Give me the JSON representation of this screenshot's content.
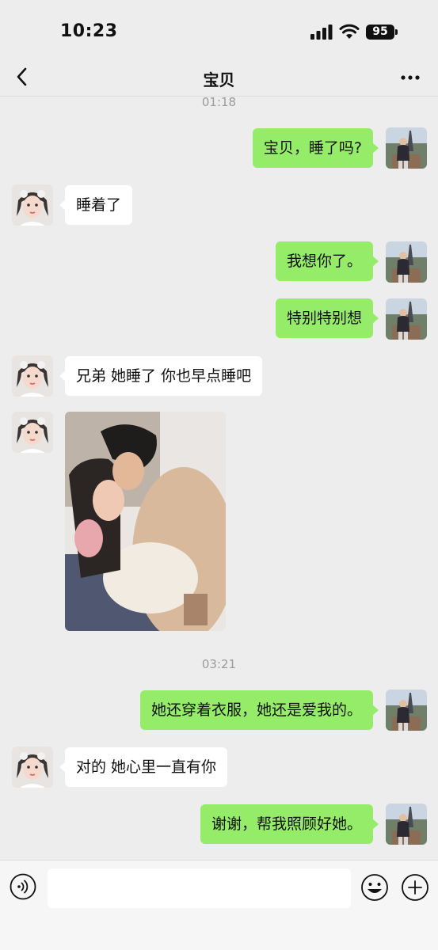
{
  "status_bar": {
    "time": "10:23",
    "battery": "95"
  },
  "nav": {
    "title": "宝贝",
    "back_icon": "chevron-left-icon",
    "more_icon": "more-dots-icon"
  },
  "timestamps": [
    "01:18",
    "03:21"
  ],
  "messages": [
    {
      "side": "sent",
      "text": "宝贝，睡了吗?"
    },
    {
      "side": "received",
      "text": "睡着了"
    },
    {
      "side": "sent",
      "text": "我想你了。"
    },
    {
      "side": "sent",
      "text": "特别特别想"
    },
    {
      "side": "received",
      "text": "兄弟 她睡了 你也早点睡吧"
    },
    {
      "side": "received",
      "type": "image"
    },
    {
      "side": "sent",
      "text": "她还穿着衣服，她还是爱我的。"
    },
    {
      "side": "received",
      "text": "对的  她心里一直有你"
    },
    {
      "side": "sent",
      "text": "谢谢，帮我照顾好她。"
    }
  ],
  "input_bar": {
    "placeholder": "",
    "voice_icon": "voice-icon",
    "emoji_icon": "emoji-icon",
    "plus_icon": "plus-circle-icon"
  },
  "colors": {
    "background": "#ededed",
    "sent_bubble": "#95ec69",
    "received_bubble": "#ffffff",
    "timestamp": "#9a9a9a"
  }
}
